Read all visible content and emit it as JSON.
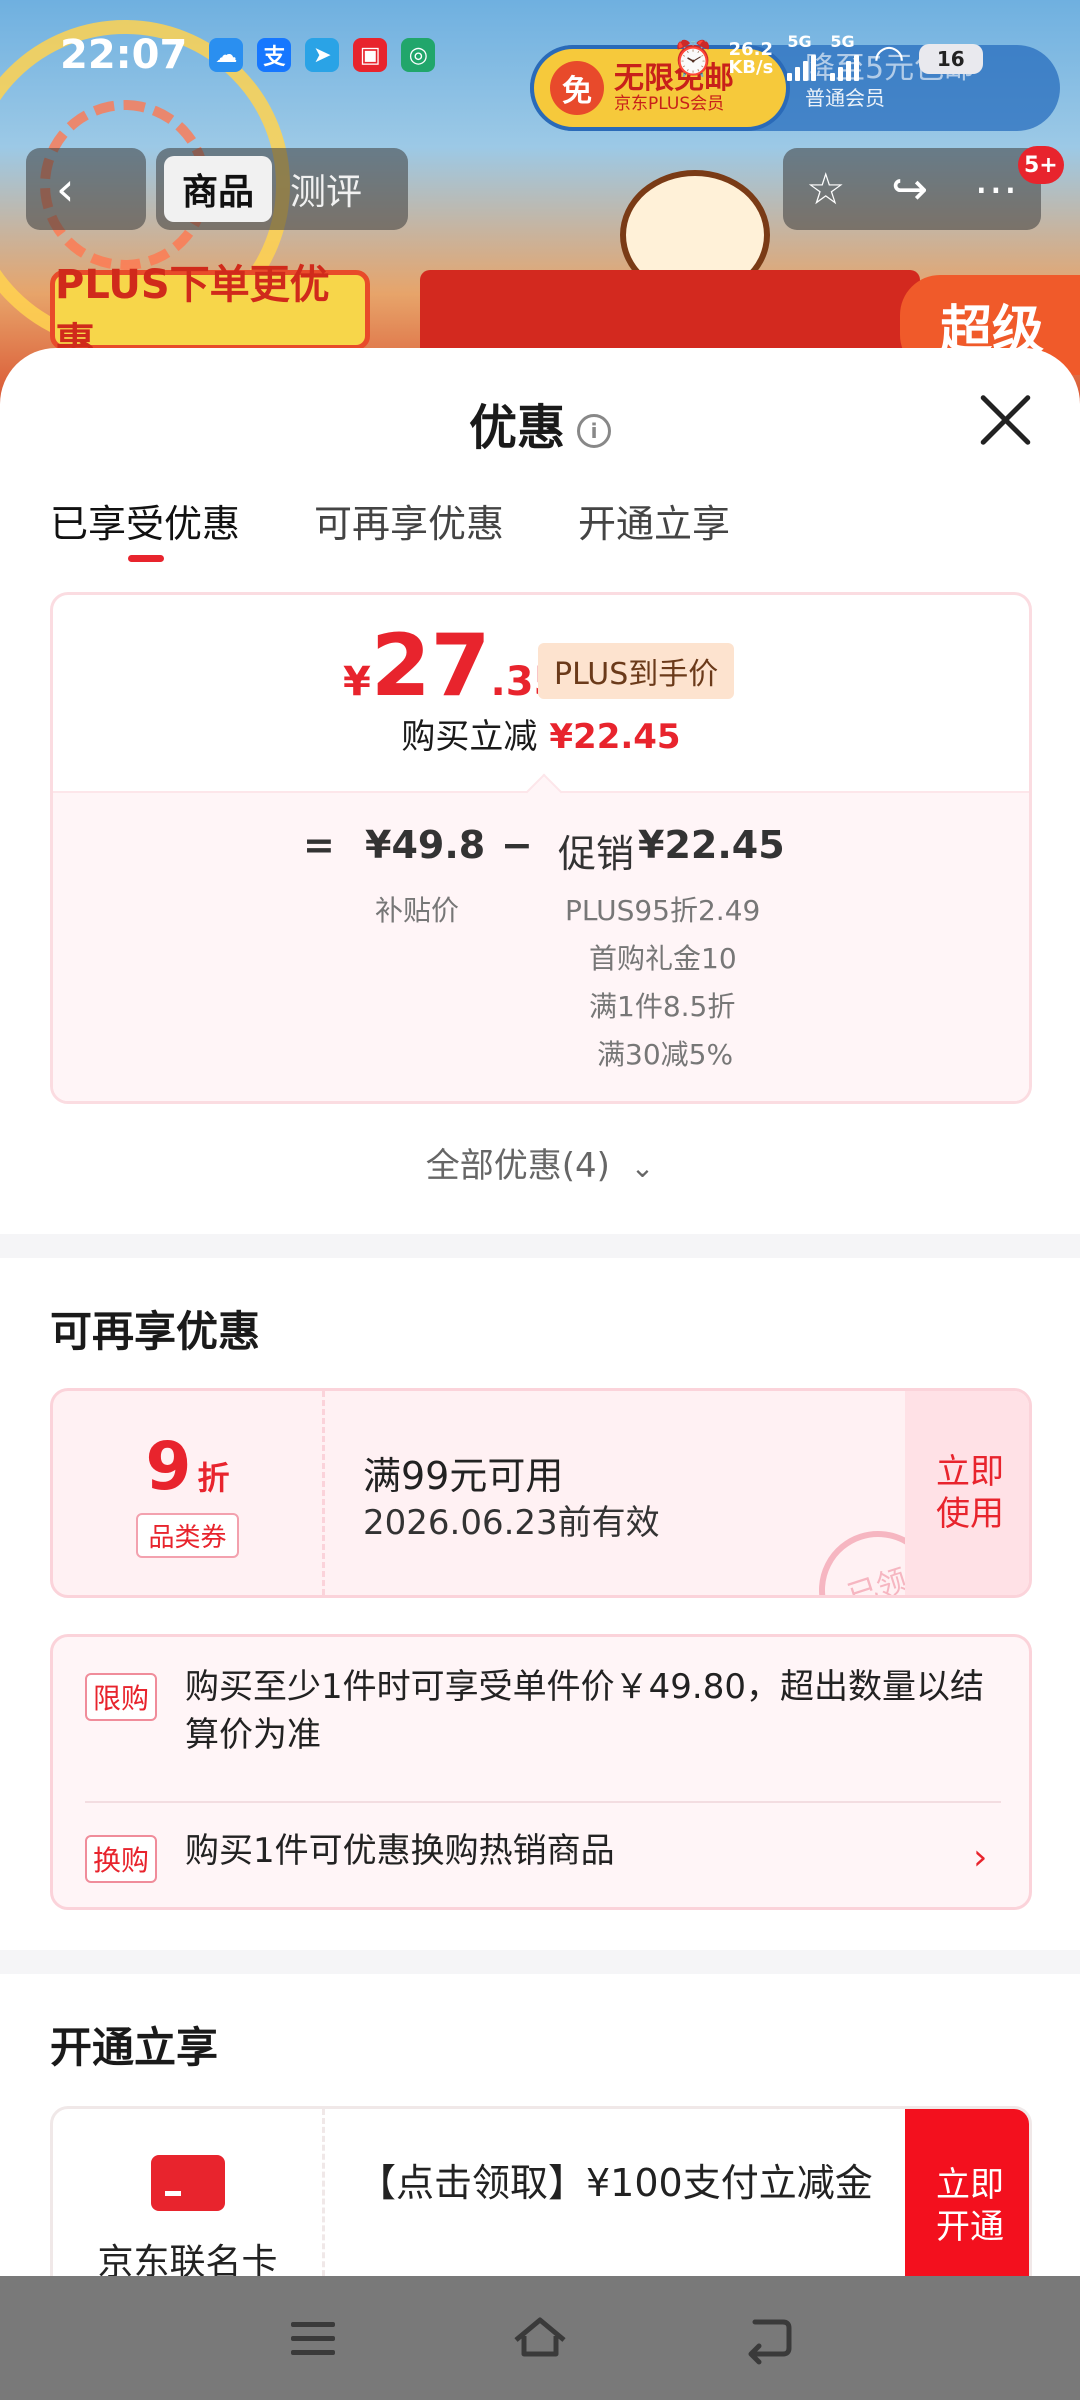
{
  "status_bar": {
    "time": "22:07",
    "net_speed_value": "26.2",
    "net_speed_unit": "KB/s",
    "sim1": "5G",
    "sim2": "5G",
    "battery": "16"
  },
  "header": {
    "plus_badge_icon": "免",
    "plus_badge_title": "无限免邮",
    "plus_badge_sub": "京东PLUS会员",
    "plus_right_title": "降至5元包邮",
    "plus_right_sub": "普通会员",
    "tabs": [
      "商品",
      "测评"
    ],
    "more_badge": "5+",
    "banner_text": "PLUS下单更优惠",
    "banner_right": "超级"
  },
  "sheet": {
    "title": "优惠",
    "info_icon": "i",
    "tabs": [
      "已享受优惠",
      "可再享优惠",
      "开通立享"
    ],
    "price_card": {
      "currency": "¥",
      "price_int": "27",
      "price_dec": ".35",
      "plus_tag": "PLUS到手价",
      "reduce_label": "购买立减",
      "reduce_value": "¥22.45",
      "eq_sign": "=",
      "subsidy_price": "¥49.8",
      "minus_sign": "−",
      "promo_label": "促销",
      "promo_value": "¥22.45",
      "subsidy_label": "补贴价",
      "promo_items": [
        "PLUS95折2.49",
        "首购礼金10",
        "满1件8.5折",
        "满30减5%"
      ]
    },
    "all_offers": "全部优惠(4)",
    "more_section": {
      "title": "可再享优惠",
      "coupon": {
        "discount_num": "9",
        "discount_unit": "折",
        "type": "品类券",
        "condition": "满99元可用",
        "expiry": "2026.06.23前有效",
        "use_label": "立即使用",
        "stamp": "已领"
      },
      "rules": [
        {
          "tag": "限购",
          "text": "购买至少1件时可享受单件价￥49.80，超出数量以结算价为准"
        },
        {
          "tag": "换购",
          "text": "购买1件可优惠换购热销商品"
        }
      ]
    },
    "open_section": {
      "title": "开通立享",
      "card_name": "京东联名卡",
      "offer_text": "【点击领取】¥100支付立减金",
      "open_label": "立即开通"
    }
  },
  "colors": {
    "accent": "#e8242d",
    "card_bg": "#fff5f7"
  }
}
